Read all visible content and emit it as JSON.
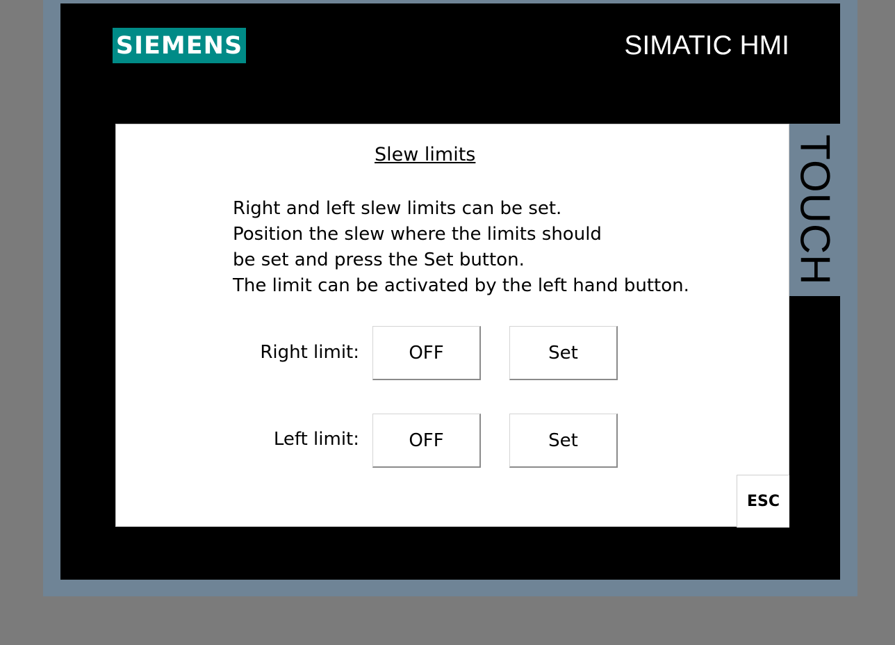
{
  "device": {
    "brand_logo": "SIEMENS",
    "product_name": "SIMATIC HMI",
    "side_label": "TOUCH",
    "colors": {
      "logo_background": "#008b87",
      "bezel": "#000000",
      "frame": "#6f8496",
      "background": "#7b7b7b",
      "screen": "#ffffff"
    }
  },
  "screen": {
    "title": "Slew limits",
    "description_lines": [
      "Right and left slew limits can be set.",
      "Position the slew where the limits should",
      "be set and press the Set button.",
      "The limit can be activated by the left hand button."
    ],
    "right_limit": {
      "label": "Right limit:",
      "toggle_label": "OFF",
      "set_label": "Set"
    },
    "left_limit": {
      "label": "Left limit:",
      "toggle_label": "OFF",
      "set_label": "Set"
    },
    "esc_label": "ESC"
  }
}
